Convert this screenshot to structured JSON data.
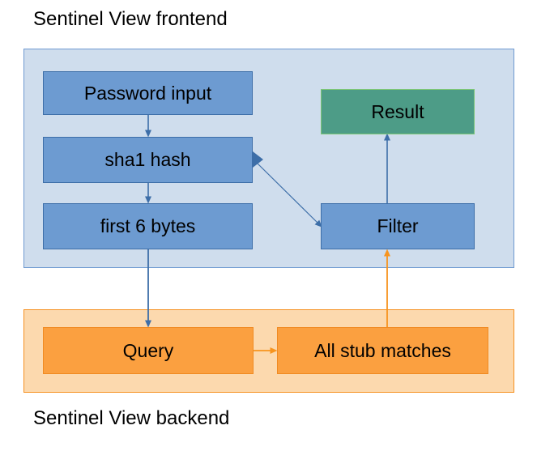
{
  "diagram": {
    "title_frontend": "Sentinel View frontend",
    "title_backend": "Sentinel View backend",
    "colors": {
      "frontend_fill": "#cfdded",
      "frontend_stroke": "#6f9ad1",
      "backend_fill": "#fcd9ae",
      "backend_stroke": "#f59121",
      "node_blue_fill": "#6d9bd1",
      "node_blue_stroke": "#3d6ea8",
      "node_green_fill": "#4d9c87",
      "node_green_stroke": "#7cc576",
      "node_orange_fill": "#fba040",
      "node_orange_stroke": "#f08a22",
      "edge_blue": "#3d6ea8",
      "edge_orange": "#f7941e"
    },
    "nodes": {
      "password_input": "Password input",
      "sha1_hash": "sha1 hash",
      "first_6_bytes": "first 6 bytes",
      "result": "Result",
      "filter": "Filter",
      "query": "Query",
      "all_stub_matches": "All stub matches"
    },
    "edges": [
      {
        "from": "Password input",
        "to": "sha1 hash",
        "color": "blue",
        "style": "arrow"
      },
      {
        "from": "sha1 hash",
        "to": "first 6 bytes",
        "color": "blue",
        "style": "arrow"
      },
      {
        "from": "sha1 hash",
        "to": "Filter",
        "color": "blue",
        "style": "diamond-arrow"
      },
      {
        "from": "first 6 bytes",
        "to": "Query",
        "color": "blue",
        "style": "arrow"
      },
      {
        "from": "Query",
        "to": "All stub matches",
        "color": "orange",
        "style": "arrow"
      },
      {
        "from": "All stub matches",
        "to": "Filter",
        "color": "orange",
        "style": "arrow"
      },
      {
        "from": "Filter",
        "to": "Result",
        "color": "blue",
        "style": "arrow"
      }
    ]
  }
}
